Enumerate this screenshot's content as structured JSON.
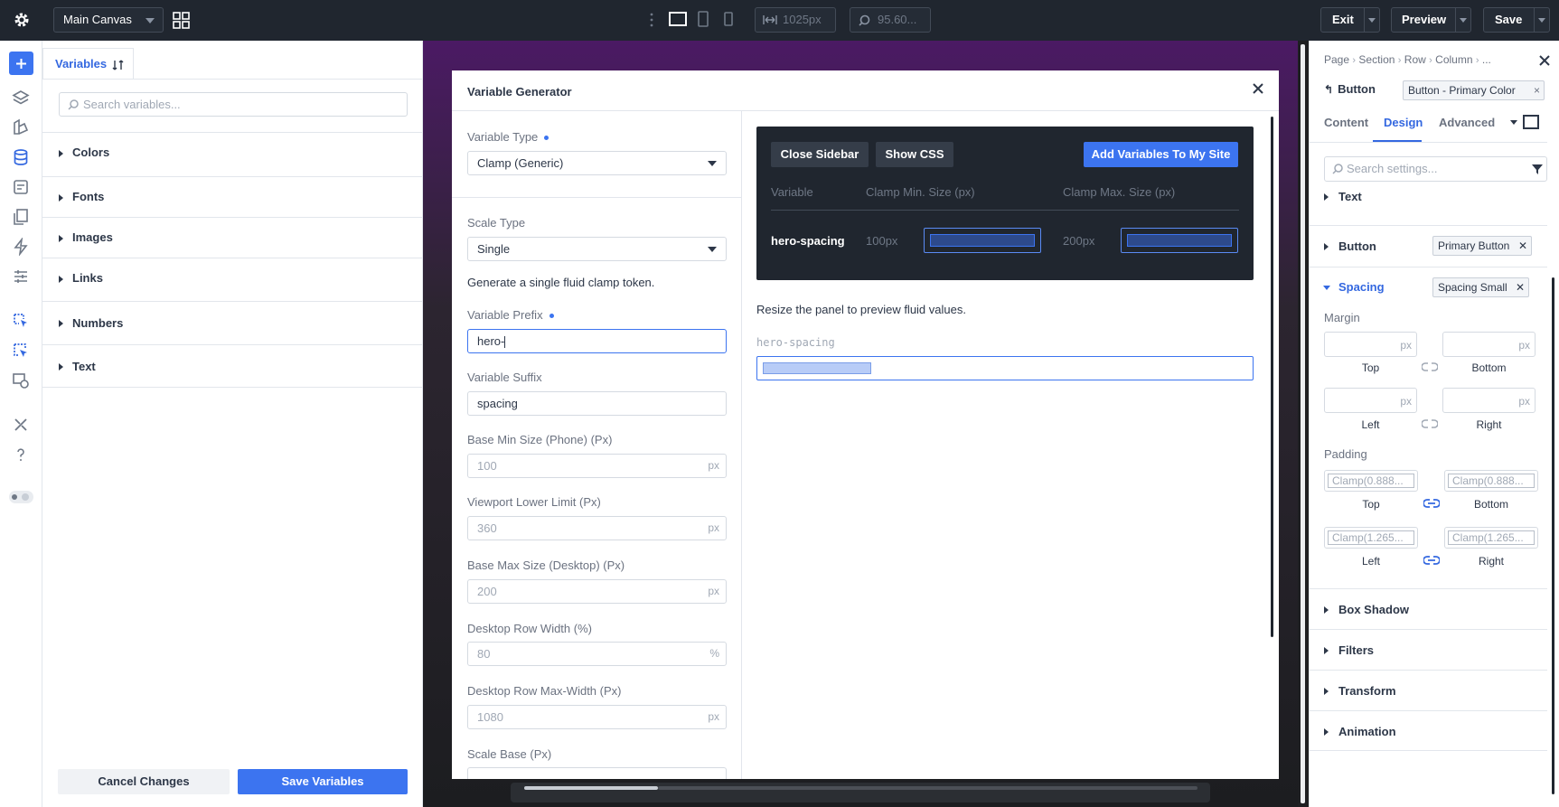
{
  "topbar": {
    "canvas_select": "Main Canvas",
    "width_value": "1025px",
    "zoom_value": "95.60...",
    "exit_label": "Exit",
    "preview_label": "Preview",
    "save_label": "Save"
  },
  "variables_panel": {
    "tab_label": "Variables",
    "search_placeholder": "Search variables...",
    "groups": [
      "Colors",
      "Fonts",
      "Images",
      "Links",
      "Numbers",
      "Text"
    ],
    "cancel_label": "Cancel Changes",
    "save_label": "Save Variables"
  },
  "modal": {
    "title": "Variable Generator",
    "variable_type": {
      "label": "Variable Type",
      "value": "Clamp (Generic)"
    },
    "scale_type": {
      "label": "Scale Type",
      "value": "Single"
    },
    "description": "Generate a single fluid clamp token.",
    "prefix": {
      "label": "Variable Prefix",
      "value": "hero-"
    },
    "suffix": {
      "label": "Variable Suffix",
      "value": "spacing"
    },
    "base_min": {
      "label": "Base Min Size (Phone) (Px)",
      "value": "100",
      "unit": "px"
    },
    "viewport_lower": {
      "label": "Viewport Lower Limit (Px)",
      "value": "360",
      "unit": "px"
    },
    "base_max": {
      "label": "Base Max Size (Desktop) (Px)",
      "value": "200",
      "unit": "px"
    },
    "row_width": {
      "label": "Desktop Row Width (%)",
      "value": "80",
      "unit": "%"
    },
    "row_max": {
      "label": "Desktop Row Max-Width (Px)",
      "value": "1080",
      "unit": "px"
    },
    "scale_base": {
      "label": "Scale Base (Px)"
    },
    "preview": {
      "close_sidebar": "Close Sidebar",
      "show_css": "Show CSS",
      "add_variables": "Add Variables To My Site",
      "col_variable": "Variable",
      "col_min": "Clamp Min. Size (px)",
      "col_max": "Clamp Max. Size (px)",
      "row_name": "hero-spacing",
      "row_min": "100px",
      "row_max": "200px"
    },
    "resize_text": "Resize the panel to preview fluid values.",
    "preview_label": "hero-spacing"
  },
  "settings_panel": {
    "breadcrumb": [
      "Page",
      "Section",
      "Row",
      "Column",
      "..."
    ],
    "element_name": "Button",
    "preset": "Button - Primary Color",
    "tabs": [
      "Content",
      "Design",
      "Advanced"
    ],
    "search_placeholder": "Search settings...",
    "sections": {
      "text": "Text",
      "button": "Button",
      "button_preset": "Primary Button",
      "spacing": "Spacing",
      "spacing_preset": "Spacing Small",
      "box_shadow": "Box Shadow",
      "filters": "Filters",
      "transform": "Transform",
      "animation": "Animation"
    },
    "margin": {
      "label": "Margin",
      "unit": "px",
      "top": "Top",
      "bottom": "Bottom",
      "left": "Left",
      "right": "Right"
    },
    "padding": {
      "label": "Padding",
      "top_value": "Clamp(0.888...",
      "bottom_value": "Clamp(0.888...",
      "left_value": "Clamp(1.265...",
      "right_value": "Clamp(1.265...",
      "top": "Top",
      "bottom": "Bottom",
      "left": "Left",
      "right": "Right"
    }
  },
  "colors": {
    "accent": "#3c74f0",
    "topbar": "#20262f",
    "canvas_purple": "#4b1a64"
  }
}
